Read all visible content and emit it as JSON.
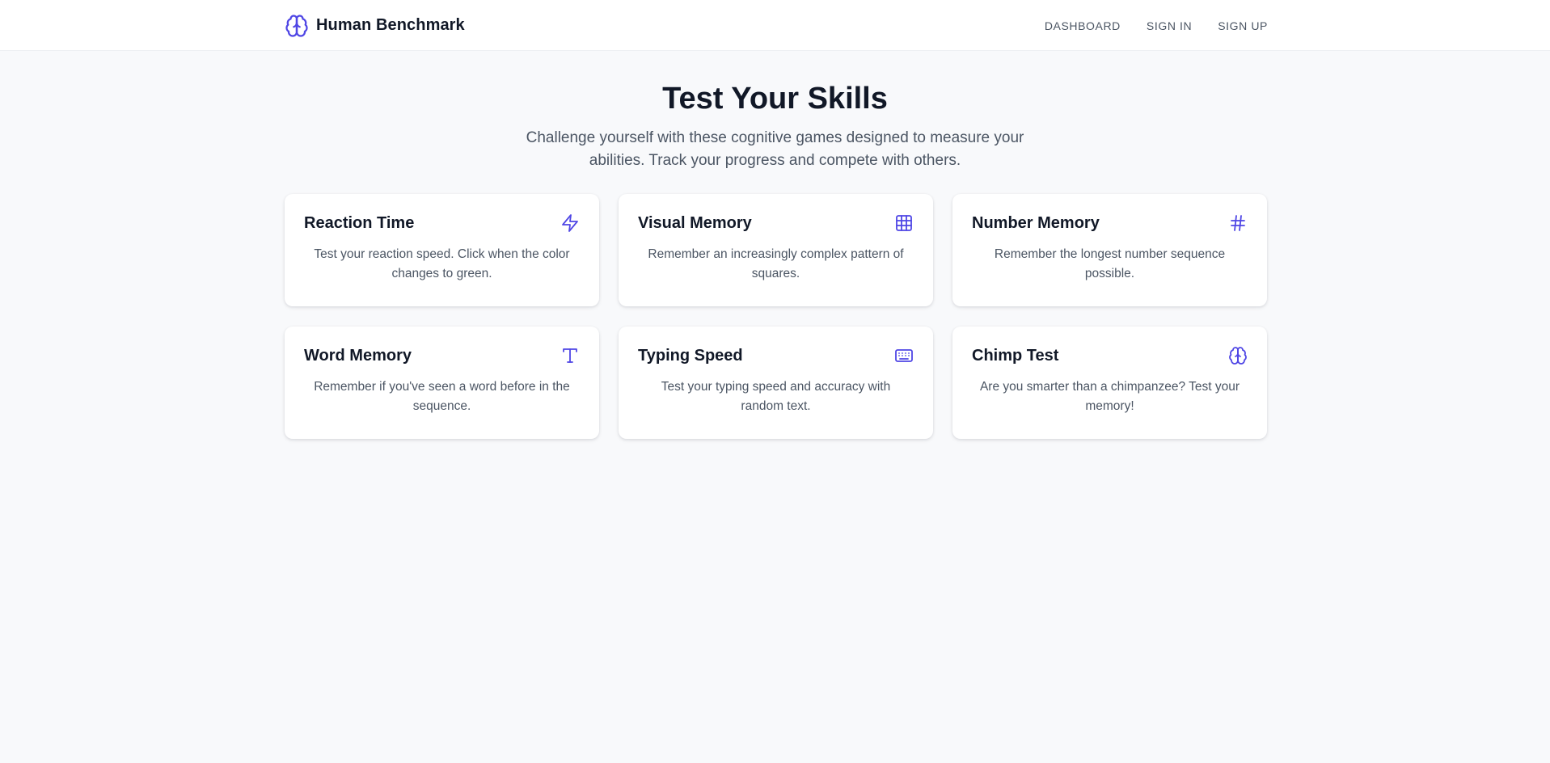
{
  "header": {
    "brand_name": "Human Benchmark",
    "brand_icon": "brain-icon",
    "nav": [
      {
        "label": "DASHBOARD"
      },
      {
        "label": "SIGN IN"
      },
      {
        "label": "SIGN UP"
      }
    ]
  },
  "hero": {
    "title": "Test Your Skills",
    "subtitle": "Challenge yourself with these cognitive games designed to measure your abilities. Track your progress and compete with others."
  },
  "games": [
    {
      "title": "Reaction Time",
      "description": "Test your reaction speed. Click when the color changes to green.",
      "icon": "lightning-icon"
    },
    {
      "title": "Visual Memory",
      "description": "Remember an increasingly complex pattern of squares.",
      "icon": "grid-icon"
    },
    {
      "title": "Number Memory",
      "description": "Remember the longest number sequence possible.",
      "icon": "hash-icon"
    },
    {
      "title": "Word Memory",
      "description": "Remember if you've seen a word before in the sequence.",
      "icon": "text-icon"
    },
    {
      "title": "Typing Speed",
      "description": "Test your typing speed and accuracy with random text.",
      "icon": "keyboard-icon"
    },
    {
      "title": "Chimp Test",
      "description": "Are you smarter than a chimpanzee? Test your memory!",
      "icon": "brain-icon"
    }
  ],
  "colors": {
    "accent": "#4f46e5",
    "page_background": "#f8f9fb",
    "card_background": "#ffffff",
    "heading_text": "#111827",
    "body_text": "#4b5563"
  }
}
